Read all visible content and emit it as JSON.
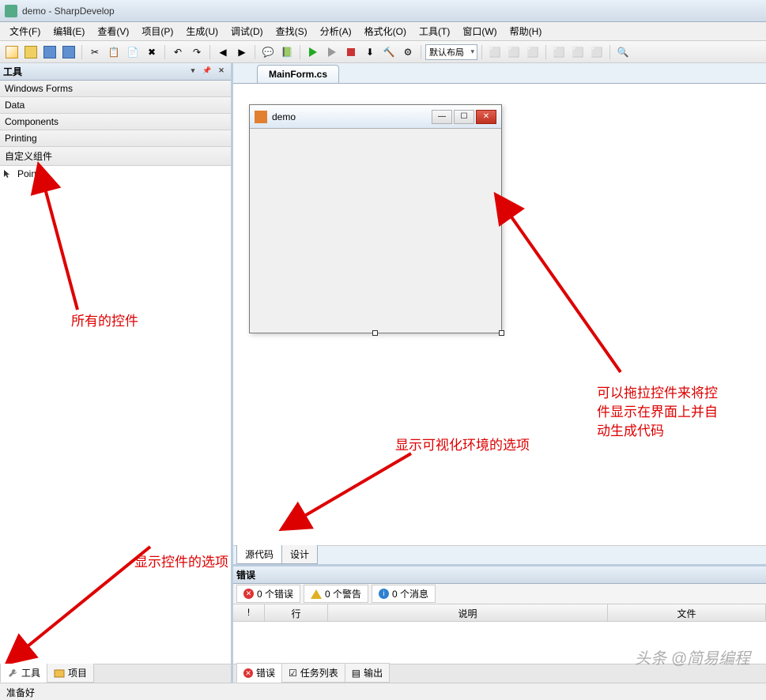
{
  "title": "demo - SharpDevelop",
  "menus": [
    "文件(F)",
    "编辑(E)",
    "查看(V)",
    "项目(P)",
    "生成(U)",
    "调试(D)",
    "查找(S)",
    "分析(A)",
    "格式化(O)",
    "工具(T)",
    "窗口(W)",
    "帮助(H)"
  ],
  "toolbar": {
    "layout_combo": "默认布局"
  },
  "toolbox": {
    "title": "工具",
    "categories": [
      "Windows Forms",
      "Data",
      "Components",
      "Printing",
      "自定义组件"
    ],
    "items": [
      "Pointer"
    ]
  },
  "left_tabs": {
    "tools": "工具",
    "project": "项目"
  },
  "doc_tab": "MainForm.cs",
  "design_form_title": "demo",
  "view_tabs": {
    "source": "源代码",
    "design": "设计"
  },
  "errors": {
    "title": "错误",
    "filters": {
      "errors": "0 个错误",
      "warnings": "0 个警告",
      "messages": "0 个消息"
    },
    "columns": {
      "bang": "!",
      "line": "行",
      "desc": "说明",
      "file": "文件"
    }
  },
  "bottom_tabs": {
    "errors": "错误",
    "tasks": "任务列表",
    "output": "输出"
  },
  "status": "准备好",
  "annotations": {
    "controls": "所有的控件",
    "show_toolbox": "显示控件的选项",
    "show_visual": "显示可视化环境的选项",
    "drag_info": "可以拖拉控件来将控件显示在界面上并自动生成代码"
  },
  "watermark": "头条 @简易编程"
}
